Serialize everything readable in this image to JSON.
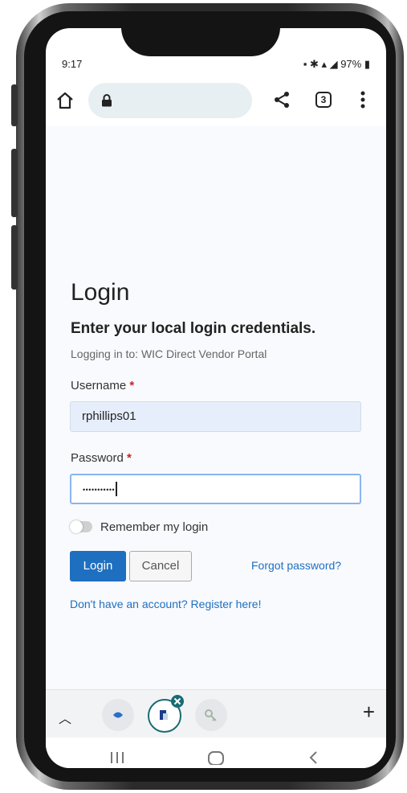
{
  "status_bar": {
    "time": "9:17",
    "battery": "97%"
  },
  "browser": {
    "tab_count": "3",
    "icons": [
      "home-icon",
      "lock-icon",
      "share-icon",
      "tab-switcher-icon",
      "more-vert-icon"
    ]
  },
  "login": {
    "title": "Login",
    "subtitle": "Enter your local login credentials.",
    "context": "Logging in to: WIC Direct Vendor Portal",
    "username_label": "Username",
    "required_marker": "*",
    "username_value": "rphillips01",
    "password_label": "Password",
    "password_value": "•••••••••••",
    "remember_label": "Remember my login",
    "remember_checked": false,
    "login_button": "Login",
    "cancel_button": "Cancel",
    "forgot_link": "Forgot password?",
    "register_link": "Don't have an account? Register here!"
  },
  "colors": {
    "primary": "#1f6fc0",
    "required": "#cc2222",
    "page_bg": "#f8fafd"
  }
}
